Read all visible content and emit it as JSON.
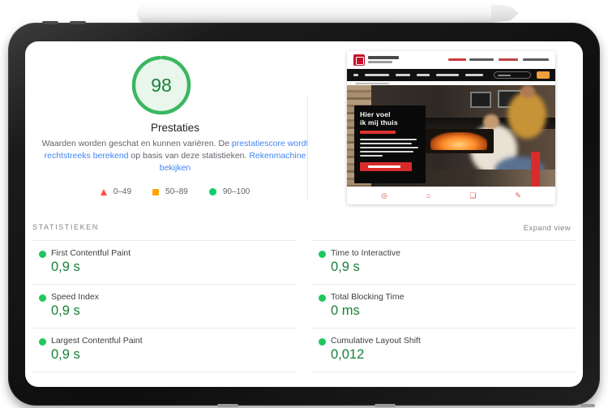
{
  "lighthouse": {
    "score": "98",
    "category_label": "Prestaties",
    "description": {
      "part1": "Waarden worden geschat en kunnen variëren. De ",
      "link1": "prestatiescore wordt rechtstreeks berekend",
      "part2": " op basis van deze statistieken. ",
      "link2": "Rekenmachine bekijken"
    },
    "legend": [
      {
        "icon": "triangle-red-icon",
        "label": "0–49",
        "color": "#ff4e42"
      },
      {
        "icon": "square-orange-icon",
        "label": "50–89",
        "color": "#ffa400"
      },
      {
        "icon": "circle-green-icon",
        "label": "90–100",
        "color": "#0cce6b"
      }
    ],
    "stats_header": "STATISTIEKEN",
    "expand_link": "Expand view",
    "metrics": [
      {
        "label": "First Contentful Paint",
        "value": "0,9 s",
        "status": "good"
      },
      {
        "label": "Speed Index",
        "value": "0,9 s",
        "status": "good"
      },
      {
        "label": "Largest Contentful Paint",
        "value": "0,9 s",
        "status": "good"
      },
      {
        "label": "Time to Interactive",
        "value": "0,9 s",
        "status": "good"
      },
      {
        "label": "Total Blocking Time",
        "value": "0 ms",
        "status": "good"
      },
      {
        "label": "Cumulative Layout Shift",
        "value": "0,012",
        "status": "good"
      }
    ],
    "colors": {
      "gauge_ring": "#3bb75f",
      "gauge_fill": "#e9f6ec",
      "value_green": "#188038",
      "dot_green": "#22c55e",
      "link_blue": "#4285f4"
    }
  },
  "site_preview": {
    "hero_title_line1": "Hier voel",
    "hero_title_line2": "ik mij thuis",
    "footer_icons": [
      "location-pin-icon",
      "home-icon",
      "gallery-icon",
      "pencil-icon"
    ],
    "accent_red": "#d92b2b",
    "toggle_orange": "#f0a03c"
  }
}
